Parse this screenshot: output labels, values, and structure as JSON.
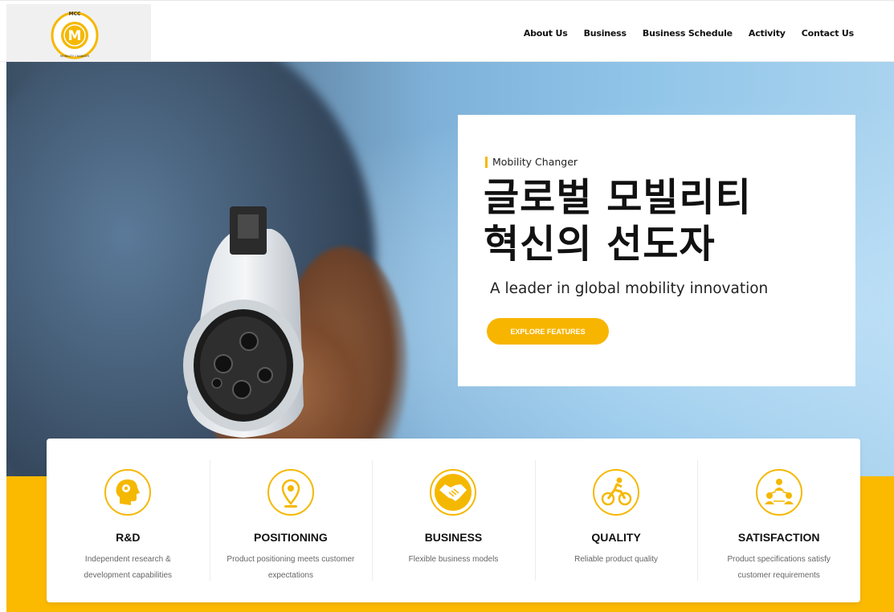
{
  "logo": {
    "top_text": "MCC",
    "letter": "M",
    "bottom_text": "MOBILITY CHANGER",
    "brand_color": "#f5b800"
  },
  "nav": {
    "items": [
      {
        "label": "About Us"
      },
      {
        "label": "Business"
      },
      {
        "label": "Business Schedule"
      },
      {
        "label": "Activity"
      },
      {
        "label": "Contact Us"
      }
    ]
  },
  "hero": {
    "eyebrow": "Mobility Changer",
    "title_line1": "글로벌 모빌리티",
    "title_line2": "혁신의 선도자",
    "subtitle": "A leader in global mobility innovation",
    "cta_label": "EXPLORE FEATURES"
  },
  "features": [
    {
      "icon": "head-brain-icon",
      "title": "R&D",
      "desc": "Independent research & development capabilities"
    },
    {
      "icon": "location-pin-icon",
      "title": "POSITIONING",
      "desc": "Product positioning meets customer expectations"
    },
    {
      "icon": "handshake-icon",
      "title": "BUSINESS",
      "desc": "Flexible business models"
    },
    {
      "icon": "cyclist-icon",
      "title": "QUALITY",
      "desc": "Reliable product quality"
    },
    {
      "icon": "people-network-icon",
      "title": "SATISFACTION",
      "desc": "Product specifications satisfy customer requirements"
    }
  ],
  "colors": {
    "accent": "#f5b800",
    "band": "#fbb900",
    "text": "#111111",
    "muted": "#666666"
  }
}
